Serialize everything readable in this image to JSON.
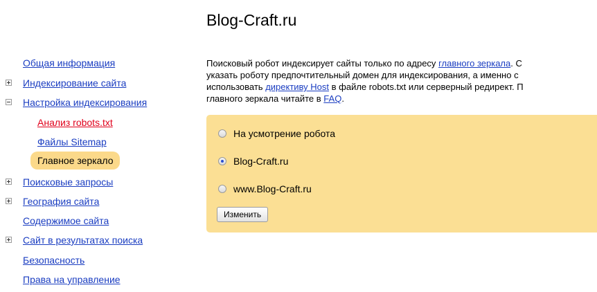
{
  "site": {
    "title": "Blog-Craft.ru"
  },
  "sidebar": {
    "items": [
      {
        "label": "Общая информация"
      },
      {
        "label": "Индексирование сайта"
      },
      {
        "label": "Настройка индексирования"
      },
      {
        "label": "Анализ robots.txt"
      },
      {
        "label": "Файлы Sitemap"
      },
      {
        "label": "Главное зеркало"
      },
      {
        "label": "Поисковые запросы"
      },
      {
        "label": "География сайта"
      },
      {
        "label": "Содержимое сайта"
      },
      {
        "label": "Сайт в результатах поиска"
      },
      {
        "label": "Безопасность"
      },
      {
        "label": "Права на управление"
      }
    ]
  },
  "content": {
    "line1_text": "Поисковый робот индексирует сайты только по адресу ",
    "line1_link": "главного зеркала",
    "line1_tail": ". С",
    "line2_text": "указать роботу предпочтительный домен для индексирования, а именно с",
    "line3_text_a": "использовать ",
    "line3_link": "директиву Host",
    "line3_text_b": " в файле robots.txt или серверный редирект. П",
    "line4_text": "главного зеркала читайте в ",
    "line4_link": "FAQ",
    "line4_tail": "."
  },
  "mirror_form": {
    "options": [
      {
        "label": "На усмотрение робота",
        "checked": false
      },
      {
        "label": "Blog-Craft.ru",
        "checked": true
      },
      {
        "label": "www.Blog-Craft.ru",
        "checked": false
      }
    ],
    "submit_label": "Изменить"
  }
}
